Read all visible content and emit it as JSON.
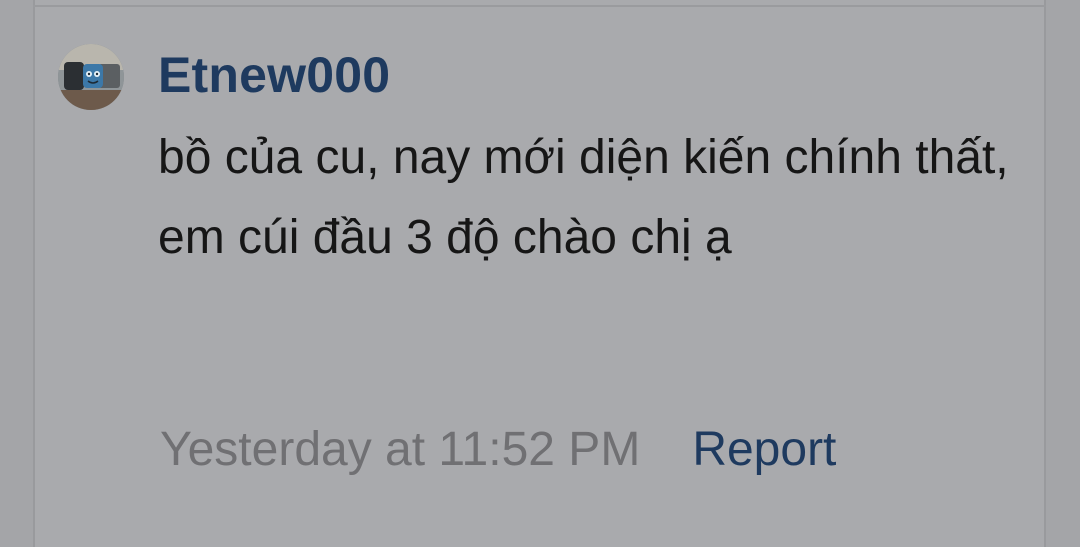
{
  "comment": {
    "avatar_icon": "user-avatar-icon",
    "username": "Etnew000",
    "message": "bồ của cu, nay mới diện kiến chính thất, em cúi đầu 3 độ chào chị ạ",
    "timestamp": "Yesterday at 11:52 PM",
    "report_label": "Report"
  },
  "colors": {
    "background": "#a9aaad",
    "username": "#1e3a5f",
    "message_text": "#161616",
    "timestamp": "#707073",
    "report_link": "#1e3a5f"
  }
}
